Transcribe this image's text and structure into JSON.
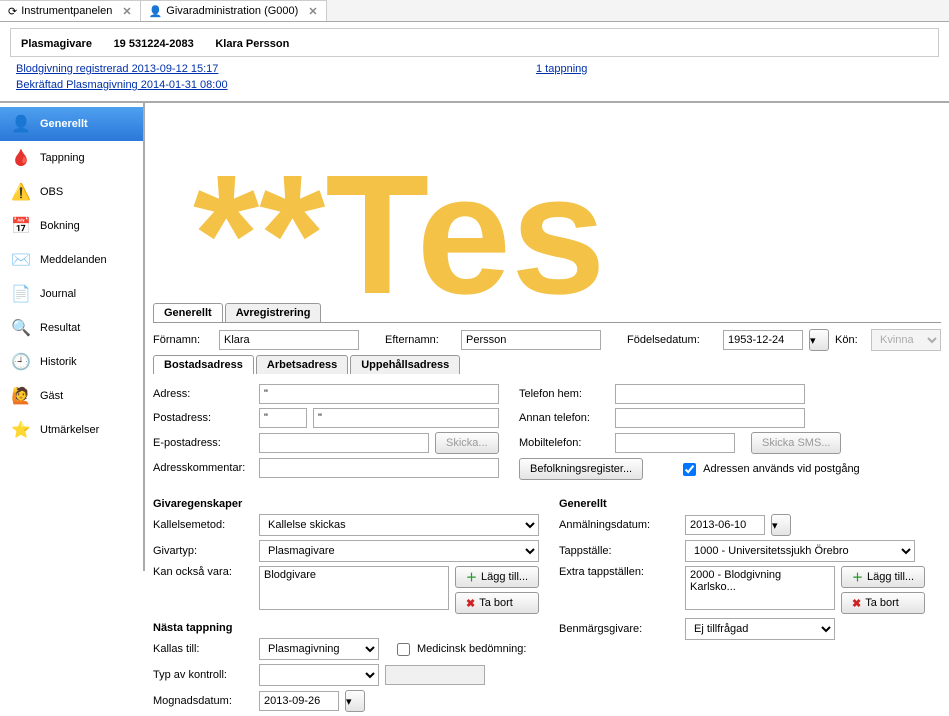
{
  "tabs": {
    "instrument": "Instrumentpanelen",
    "givaradmin": "Givaradministration (G000)"
  },
  "header": {
    "donor_type": "Plasmagivare",
    "personnr": "19 531224-2083",
    "name": "Klara  Persson"
  },
  "links": {
    "l1": "Blodgivning registrerad 2013-09-12 15:17",
    "l2": "Bekräftad Plasmagivning 2014-01-31 08:00",
    "l3": "1 tappning"
  },
  "sidebar": {
    "items": [
      {
        "label": "Generellt",
        "icon": "👤"
      },
      {
        "label": "Tappning",
        "icon": "🩸"
      },
      {
        "label": "OBS",
        "icon": "⚠️"
      },
      {
        "label": "Bokning",
        "icon": "📅"
      },
      {
        "label": "Meddelanden",
        "icon": "✉️"
      },
      {
        "label": "Journal",
        "icon": "📄"
      },
      {
        "label": "Resultat",
        "icon": "🔍"
      },
      {
        "label": "Historik",
        "icon": "🕘"
      },
      {
        "label": "Gäst",
        "icon": "🙋"
      },
      {
        "label": "Utmärkelser",
        "icon": "⭐"
      }
    ]
  },
  "content": {
    "subtabs": {
      "gen": "Generellt",
      "avreg": "Avregistrering"
    },
    "labels": {
      "fornamn": "Förnamn:",
      "efternamn": "Efternamn:",
      "fodelsedatum": "Födelsedatum:",
      "kon": "Kön:",
      "bostad": "Bostadsadress",
      "arbete": "Arbetsadress",
      "uppehall": "Uppehållsadress",
      "adress": "Adress:",
      "postadress": "Postadress:",
      "epost": "E-postadress:",
      "adresskommentar": "Adresskommentar:",
      "telefon_hem": "Telefon hem:",
      "annan_tel": "Annan telefon:",
      "mobil": "Mobiltelefon:",
      "skicka": "Skicka...",
      "befolkning": "Befolkningsregister...",
      "skicka_sms": "Skicka SMS...",
      "adress_chk": "Adressen används vid postgång",
      "givaregenskaper": "Givaregenskaper",
      "kallelsemetod": "Kallelsemetod:",
      "givartyp": "Givartyp:",
      "kan_ocksa": "Kan också vara:",
      "blodgivare": "Blodgivare",
      "lagg_till": "Lägg till...",
      "ta_bort": "Ta bort",
      "generellt2": "Generellt",
      "anmalning": "Anmälningsdatum:",
      "tappstalle": "Tappställe:",
      "extra_tapp": "Extra tappställen:",
      "benmargs": "Benmärgsgivare:",
      "nasta": "Nästa tappning",
      "kallas": "Kallas till:",
      "medicinsk": "Medicinsk bedömning:",
      "typ_kontroll": "Typ av kontroll:",
      "mognads": "Mognadsdatum:"
    },
    "values": {
      "fornamn": "Klara",
      "efternamn": "Persson",
      "fodelsedatum": "1953-12-24",
      "kon": "Kvinna",
      "adress": "\"",
      "post1": "\"",
      "post2": "\"",
      "kallelsemetod": "Kallelse skickas",
      "givartyp": "Plasmagivare",
      "anmalning": "2013-06-10",
      "tappstalle": "1000 - Universitetssjukh Örebro",
      "extra_item": "2000 - Blodgivning Karlsko...",
      "benmargs": "Ej tillfrågad",
      "kallas": "Plasmagivning",
      "mognads": "2013-09-26"
    },
    "watermark": "**Tes"
  }
}
